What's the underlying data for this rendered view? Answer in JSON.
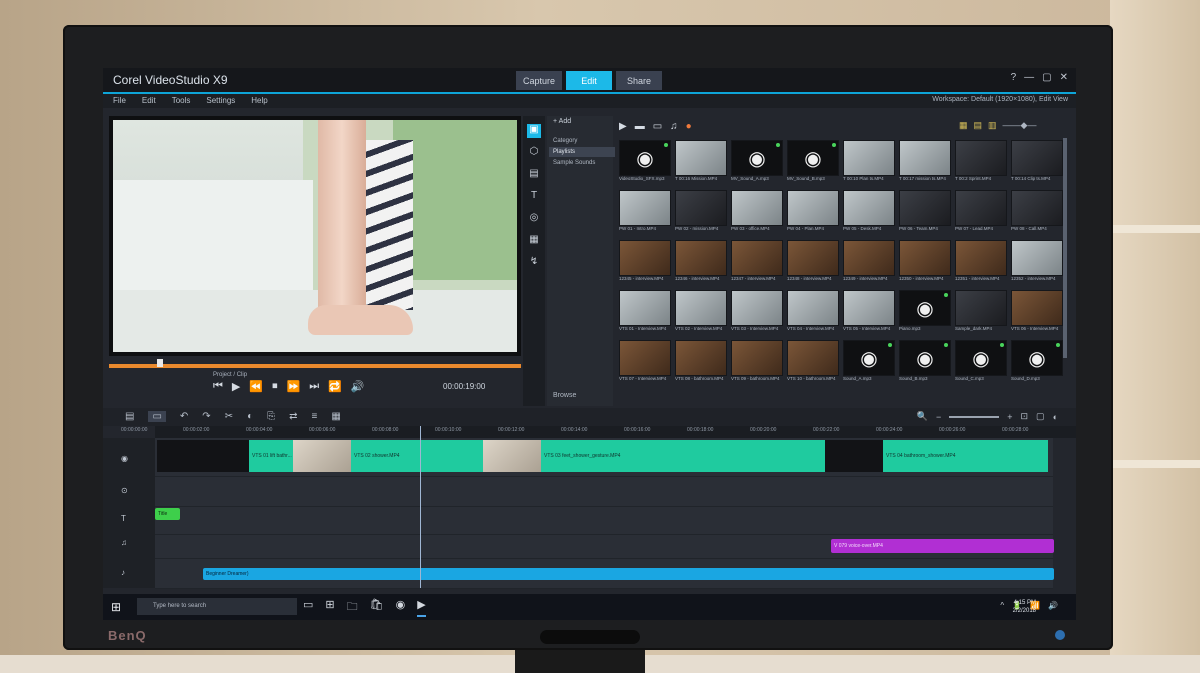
{
  "app": {
    "title": "Corel VideoStudio X9",
    "tabs": [
      "Capture",
      "Edit",
      "Share"
    ],
    "active_tab": "Edit",
    "window_controls": [
      "?",
      "—",
      "▢",
      "✕"
    ],
    "menu": [
      "File",
      "Edit",
      "Tools",
      "Settings",
      "Help"
    ],
    "workspace_label": "Workspace: Default (1920×1080), Edit View"
  },
  "preview": {
    "project_label": "Project",
    "clip_label": "Clip",
    "timecode": "00:00:19:00",
    "transport": [
      "⏮",
      "▶",
      "⏪",
      "⏹",
      "⏩",
      "⏭",
      "🔁",
      "🔊"
    ],
    "progress": 1.0
  },
  "library": {
    "add_label": "+ Add",
    "nav": [
      "Category",
      "Playlists",
      "Sample Sounds"
    ],
    "nav_selected": "Playlists",
    "browse_label": "Browse",
    "toolbar_icons": [
      "folder",
      "video",
      "photo",
      "audio",
      "effect"
    ],
    "thumbs": [
      {
        "type": "audio",
        "caption": "VideoStudio_SFX.mp3"
      },
      {
        "type": "light",
        "caption": "T 00:16 Mission.MP4"
      },
      {
        "type": "audio",
        "caption": "MV_Sound_A.mp3"
      },
      {
        "type": "audio",
        "caption": "MV_Sound_B.mp3"
      },
      {
        "type": "light",
        "caption": "T 00:10 Plan ts.MP4"
      },
      {
        "type": "light",
        "caption": "T 00:17 mission ts.MP4"
      },
      {
        "type": "dark",
        "caption": "T 00:2 Sprint.MP4"
      },
      {
        "type": "dark",
        "caption": "T 00:14 Clip ts.MP4"
      },
      {
        "type": "light",
        "caption": "PW 01 - Intro.MP4"
      },
      {
        "type": "dark",
        "caption": "PW 02 - mission.MP4"
      },
      {
        "type": "light",
        "caption": "PW 03 - office.MP4"
      },
      {
        "type": "light",
        "caption": "PW 04 - Plan.MP4"
      },
      {
        "type": "light",
        "caption": "PW 05 - Desk.MP4"
      },
      {
        "type": "dark",
        "caption": "PW 06 - Team.MP4"
      },
      {
        "type": "dark",
        "caption": "PW 07 - Lead.MP4"
      },
      {
        "type": "dark",
        "caption": "PW 08 - Call.MP4"
      },
      {
        "type": "warm",
        "caption": "12345 - interview.MP4"
      },
      {
        "type": "warm",
        "caption": "12346 - interview.MP4"
      },
      {
        "type": "warm",
        "caption": "12347 - interview.MP4"
      },
      {
        "type": "warm",
        "caption": "12348 - interview.MP4"
      },
      {
        "type": "warm",
        "caption": "12349 - interview.MP4"
      },
      {
        "type": "warm",
        "caption": "12350 - interview.MP4"
      },
      {
        "type": "warm",
        "caption": "12351 - interview.MP4"
      },
      {
        "type": "light",
        "caption": "12352 - interview.MP4"
      },
      {
        "type": "light",
        "caption": "VTS 01 - Interview.MP4"
      },
      {
        "type": "light",
        "caption": "VTS 02 - Interview.MP4"
      },
      {
        "type": "light",
        "caption": "VTS 03 - Interview.MP4"
      },
      {
        "type": "light",
        "caption": "VTS 04 - Interview.MP4"
      },
      {
        "type": "light",
        "caption": "VTS 05 - Interview.MP4"
      },
      {
        "type": "audio",
        "caption": "Piano.mp3"
      },
      {
        "type": "dark",
        "caption": "Sample_dark.MP4"
      },
      {
        "type": "warm",
        "caption": "VTS 06 - Interview.MP4"
      },
      {
        "type": "warm",
        "caption": "VTS 07 - Interview.MP4"
      },
      {
        "type": "warm",
        "caption": "VTS 08 - bathroom.MP4"
      },
      {
        "type": "warm",
        "caption": "VTS 09 - bathroom.MP4"
      },
      {
        "type": "warm",
        "caption": "VTS 10 - bathroom.MP4"
      },
      {
        "type": "audio",
        "caption": "Sound_A.mp3"
      },
      {
        "type": "audio",
        "caption": "Sound_B.mp3"
      },
      {
        "type": "audio",
        "caption": "Sound_C.mp3"
      },
      {
        "type": "audio",
        "caption": "Sound_D.mp3"
      }
    ]
  },
  "timeline": {
    "tools": [
      "▤",
      "▭",
      "↶",
      "↷",
      "✂",
      "◐",
      "⎘",
      "⇄",
      "≡",
      "▦"
    ],
    "zoom_icons": [
      "🔍",
      "−",
      "+",
      "⊡",
      "▢",
      "◐"
    ],
    "ruler_start": "00:00:00:00",
    "ruler_ticks": [
      "00:00:02:00",
      "00:00:04:00",
      "00:00:06:00",
      "00:00:08:00",
      "00:00:10:00",
      "00:00:12:00",
      "00:00:14:00",
      "00:00:16:00",
      "00:00:18:00",
      "00:00:20:00",
      "00:00:22:00",
      "00:00:24:00",
      "00:00:26:00",
      "00:00:28:00"
    ],
    "track_icons": [
      "◉",
      "⊙",
      "T",
      "♫",
      "♪"
    ],
    "video_clips": [
      {
        "kind": "dark",
        "label": ""
      },
      {
        "kind": "teal",
        "label": "VTS 01 lift bathr..."
      },
      {
        "kind": "photo",
        "label": ""
      },
      {
        "kind": "teal",
        "label": "VTS 02 shower.MP4"
      },
      {
        "kind": "photo",
        "label": ""
      },
      {
        "kind": "teal",
        "label": "VTS 03 feet_shower_gesture.MP4"
      },
      {
        "kind": "dark",
        "label": ""
      },
      {
        "kind": "teal",
        "label": "VTS 04 bathroom_shower.MP4"
      }
    ],
    "title_clip": "Title",
    "voice_clip": "V 079 voice-over.MP4",
    "music_clip": "Beginner Dreamer)"
  },
  "taskbar": {
    "search_placeholder": "Type here to search",
    "apps": [
      "▭",
      "⊞",
      "🗀",
      "🛍",
      "◉",
      "▶"
    ],
    "tray": [
      "^",
      "🔋",
      "📶",
      "🔊"
    ],
    "time": "4:15 PM",
    "date": "2/2/2018"
  },
  "monitor": {
    "brand": "BenQ"
  }
}
